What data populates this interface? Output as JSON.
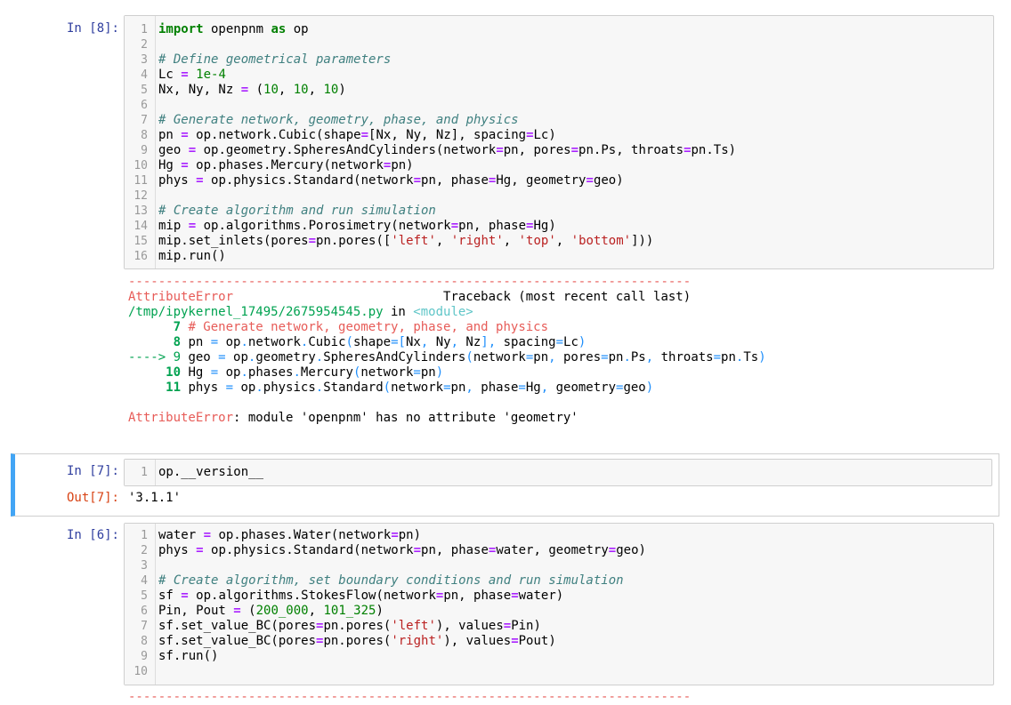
{
  "cells": [
    {
      "prompt": "In [8]:",
      "line_numbers": [
        "1",
        "2",
        "3",
        "4",
        "5",
        "6",
        "7",
        "8",
        "9",
        "10",
        "11",
        "12",
        "13",
        "14",
        "15",
        "16"
      ],
      "lines": [
        [
          [
            "kw",
            "import"
          ],
          [
            "t",
            " openpnm "
          ],
          [
            "kw",
            "as"
          ],
          [
            "t",
            " op"
          ]
        ],
        [],
        [
          [
            "cm",
            "# Define geometrical parameters"
          ]
        ],
        [
          [
            "t",
            "Lc "
          ],
          [
            "op",
            "="
          ],
          [
            "t",
            " "
          ],
          [
            "num",
            "1e-4"
          ]
        ],
        [
          [
            "t",
            "Nx, Ny, Nz "
          ],
          [
            "op",
            "="
          ],
          [
            "t",
            " ("
          ],
          [
            "num",
            "10"
          ],
          [
            "t",
            ", "
          ],
          [
            "num",
            "10"
          ],
          [
            "t",
            ", "
          ],
          [
            "num",
            "10"
          ],
          [
            "t",
            ")"
          ]
        ],
        [],
        [
          [
            "cm",
            "# Generate network, geometry, phase, and physics"
          ]
        ],
        [
          [
            "t",
            "pn "
          ],
          [
            "op",
            "="
          ],
          [
            "t",
            " op.network.Cubic(shape"
          ],
          [
            "op",
            "="
          ],
          [
            "t",
            "[Nx, Ny, Nz], spacing"
          ],
          [
            "op",
            "="
          ],
          [
            "t",
            "Lc)"
          ]
        ],
        [
          [
            "t",
            "geo "
          ],
          [
            "op",
            "="
          ],
          [
            "t",
            " op.geometry.SpheresAndCylinders(network"
          ],
          [
            "op",
            "="
          ],
          [
            "t",
            "pn, pores"
          ],
          [
            "op",
            "="
          ],
          [
            "t",
            "pn.Ps, throats"
          ],
          [
            "op",
            "="
          ],
          [
            "t",
            "pn.Ts)"
          ]
        ],
        [
          [
            "t",
            "Hg "
          ],
          [
            "op",
            "="
          ],
          [
            "t",
            " op.phases.Mercury(network"
          ],
          [
            "op",
            "="
          ],
          [
            "t",
            "pn)"
          ]
        ],
        [
          [
            "t",
            "phys "
          ],
          [
            "op",
            "="
          ],
          [
            "t",
            " op.physics.Standard(network"
          ],
          [
            "op",
            "="
          ],
          [
            "t",
            "pn, phase"
          ],
          [
            "op",
            "="
          ],
          [
            "t",
            "Hg, geometry"
          ],
          [
            "op",
            "="
          ],
          [
            "t",
            "geo)"
          ]
        ],
        [],
        [
          [
            "cm",
            "# Create algorithm and run simulation"
          ]
        ],
        [
          [
            "t",
            "mip "
          ],
          [
            "op",
            "="
          ],
          [
            "t",
            " op.algorithms.Porosimetry(network"
          ],
          [
            "op",
            "="
          ],
          [
            "t",
            "pn, phase"
          ],
          [
            "op",
            "="
          ],
          [
            "t",
            "Hg)"
          ]
        ],
        [
          [
            "t",
            "mip.set_inlets(pores"
          ],
          [
            "op",
            "="
          ],
          [
            "t",
            "pn.pores(["
          ],
          [
            "str",
            "'left'"
          ],
          [
            "t",
            ", "
          ],
          [
            "str",
            "'right'"
          ],
          [
            "t",
            ", "
          ],
          [
            "str",
            "'top'"
          ],
          [
            "t",
            ", "
          ],
          [
            "str",
            "'bottom'"
          ],
          [
            "t",
            "]))"
          ]
        ],
        [
          [
            "t",
            "mip.run()"
          ]
        ]
      ],
      "traceback": [
        [
          [
            "ansi-red",
            "---------------------------------------------------------------------------"
          ]
        ],
        [
          [
            "ansi-red",
            "AttributeError"
          ],
          [
            "t",
            "                            Traceback (most recent call last)"
          ]
        ],
        [
          [
            "ansi-green",
            "/tmp/ipykernel_17495/2675954545.py"
          ],
          [
            "t",
            " in "
          ],
          [
            "ansi-cyan",
            "<module>"
          ]
        ],
        [
          [
            "t",
            "      "
          ],
          [
            "ansi-green-b",
            "7"
          ],
          [
            "t",
            " "
          ],
          [
            "ansi-red",
            "# Generate network, geometry, phase, and physics"
          ]
        ],
        [
          [
            "t",
            "      "
          ],
          [
            "ansi-green-b",
            "8"
          ],
          [
            "t",
            " pn "
          ],
          [
            "ansi-blue",
            "="
          ],
          [
            "t",
            " op"
          ],
          [
            "ansi-blue",
            "."
          ],
          [
            "t",
            "network"
          ],
          [
            "ansi-blue",
            "."
          ],
          [
            "t",
            "Cubic"
          ],
          [
            "ansi-blue",
            "("
          ],
          [
            "t",
            "shape"
          ],
          [
            "ansi-blue",
            "=["
          ],
          [
            "t",
            "Nx"
          ],
          [
            "ansi-blue",
            ","
          ],
          [
            "t",
            " Ny"
          ],
          [
            "ansi-blue",
            ","
          ],
          [
            "t",
            " Nz"
          ],
          [
            "ansi-blue",
            "],"
          ],
          [
            "t",
            " spacing"
          ],
          [
            "ansi-blue",
            "="
          ],
          [
            "t",
            "Lc"
          ],
          [
            "ansi-blue",
            ")"
          ]
        ],
        [
          [
            "ansi-green",
            "----> 9"
          ],
          [
            "t",
            " geo "
          ],
          [
            "ansi-blue",
            "="
          ],
          [
            "t",
            " op"
          ],
          [
            "ansi-blue",
            "."
          ],
          [
            "t",
            "geometry"
          ],
          [
            "ansi-blue",
            "."
          ],
          [
            "t",
            "SpheresAndCylinders"
          ],
          [
            "ansi-blue",
            "("
          ],
          [
            "t",
            "network"
          ],
          [
            "ansi-blue",
            "="
          ],
          [
            "t",
            "pn"
          ],
          [
            "ansi-blue",
            ","
          ],
          [
            "t",
            " pores"
          ],
          [
            "ansi-blue",
            "="
          ],
          [
            "t",
            "pn"
          ],
          [
            "ansi-blue",
            "."
          ],
          [
            "t",
            "Ps"
          ],
          [
            "ansi-blue",
            ","
          ],
          [
            "t",
            " throats"
          ],
          [
            "ansi-blue",
            "="
          ],
          [
            "t",
            "pn"
          ],
          [
            "ansi-blue",
            "."
          ],
          [
            "t",
            "Ts"
          ],
          [
            "ansi-blue",
            ")"
          ]
        ],
        [
          [
            "t",
            "     "
          ],
          [
            "ansi-green-b",
            "10"
          ],
          [
            "t",
            " Hg "
          ],
          [
            "ansi-blue",
            "="
          ],
          [
            "t",
            " op"
          ],
          [
            "ansi-blue",
            "."
          ],
          [
            "t",
            "phases"
          ],
          [
            "ansi-blue",
            "."
          ],
          [
            "t",
            "Mercury"
          ],
          [
            "ansi-blue",
            "("
          ],
          [
            "t",
            "network"
          ],
          [
            "ansi-blue",
            "="
          ],
          [
            "t",
            "pn"
          ],
          [
            "ansi-blue",
            ")"
          ]
        ],
        [
          [
            "t",
            "     "
          ],
          [
            "ansi-green-b",
            "11"
          ],
          [
            "t",
            " phys "
          ],
          [
            "ansi-blue",
            "="
          ],
          [
            "t",
            " op"
          ],
          [
            "ansi-blue",
            "."
          ],
          [
            "t",
            "physics"
          ],
          [
            "ansi-blue",
            "."
          ],
          [
            "t",
            "Standard"
          ],
          [
            "ansi-blue",
            "("
          ],
          [
            "t",
            "network"
          ],
          [
            "ansi-blue",
            "="
          ],
          [
            "t",
            "pn"
          ],
          [
            "ansi-blue",
            ","
          ],
          [
            "t",
            " phase"
          ],
          [
            "ansi-blue",
            "="
          ],
          [
            "t",
            "Hg"
          ],
          [
            "ansi-blue",
            ","
          ],
          [
            "t",
            " geometry"
          ],
          [
            "ansi-blue",
            "="
          ],
          [
            "t",
            "geo"
          ],
          [
            "ansi-blue",
            ")"
          ]
        ],
        [],
        [
          [
            "ansi-red",
            "AttributeError"
          ],
          [
            "t",
            ": module 'openpnm' has no attribute 'geometry'"
          ]
        ]
      ]
    },
    {
      "prompt": "In [7]:",
      "line_numbers": [
        "1"
      ],
      "lines": [
        [
          [
            "t",
            "op.__version__"
          ]
        ]
      ],
      "out_prompt": "Out[7]:",
      "output": "'3.1.1'"
    },
    {
      "prompt": "In [6]:",
      "line_numbers": [
        "1",
        "2",
        "3",
        "4",
        "5",
        "6",
        "7",
        "8",
        "9",
        "10"
      ],
      "lines": [
        [
          [
            "t",
            "water "
          ],
          [
            "op",
            "="
          ],
          [
            "t",
            " op.phases.Water(network"
          ],
          [
            "op",
            "="
          ],
          [
            "t",
            "pn)"
          ]
        ],
        [
          [
            "t",
            "phys "
          ],
          [
            "op",
            "="
          ],
          [
            "t",
            " op.physics.Standard(network"
          ],
          [
            "op",
            "="
          ],
          [
            "t",
            "pn, phase"
          ],
          [
            "op",
            "="
          ],
          [
            "t",
            "water, geometry"
          ],
          [
            "op",
            "="
          ],
          [
            "t",
            "geo)"
          ]
        ],
        [],
        [
          [
            "cm",
            "# Create algorithm, set boundary conditions and run simulation"
          ]
        ],
        [
          [
            "t",
            "sf "
          ],
          [
            "op",
            "="
          ],
          [
            "t",
            " op.algorithms.StokesFlow(network"
          ],
          [
            "op",
            "="
          ],
          [
            "t",
            "pn, phase"
          ],
          [
            "op",
            "="
          ],
          [
            "t",
            "water)"
          ]
        ],
        [
          [
            "t",
            "Pin, Pout "
          ],
          [
            "op",
            "="
          ],
          [
            "t",
            " ("
          ],
          [
            "num",
            "200_000"
          ],
          [
            "t",
            ", "
          ],
          [
            "num",
            "101_325"
          ],
          [
            "t",
            ")"
          ]
        ],
        [
          [
            "t",
            "sf.set_value_BC(pores"
          ],
          [
            "op",
            "="
          ],
          [
            "t",
            "pn.pores("
          ],
          [
            "str",
            "'left'"
          ],
          [
            "t",
            "), values"
          ],
          [
            "op",
            "="
          ],
          [
            "t",
            "Pin)"
          ]
        ],
        [
          [
            "t",
            "sf.set_value_BC(pores"
          ],
          [
            "op",
            "="
          ],
          [
            "t",
            "pn.pores("
          ],
          [
            "str",
            "'right'"
          ],
          [
            "t",
            "), values"
          ],
          [
            "op",
            "="
          ],
          [
            "t",
            "Pout)"
          ]
        ],
        [
          [
            "t",
            "sf.run()"
          ]
        ],
        []
      ],
      "traceback": [
        [
          [
            "ansi-red",
            "---------------------------------------------------------------------------"
          ]
        ]
      ]
    }
  ]
}
